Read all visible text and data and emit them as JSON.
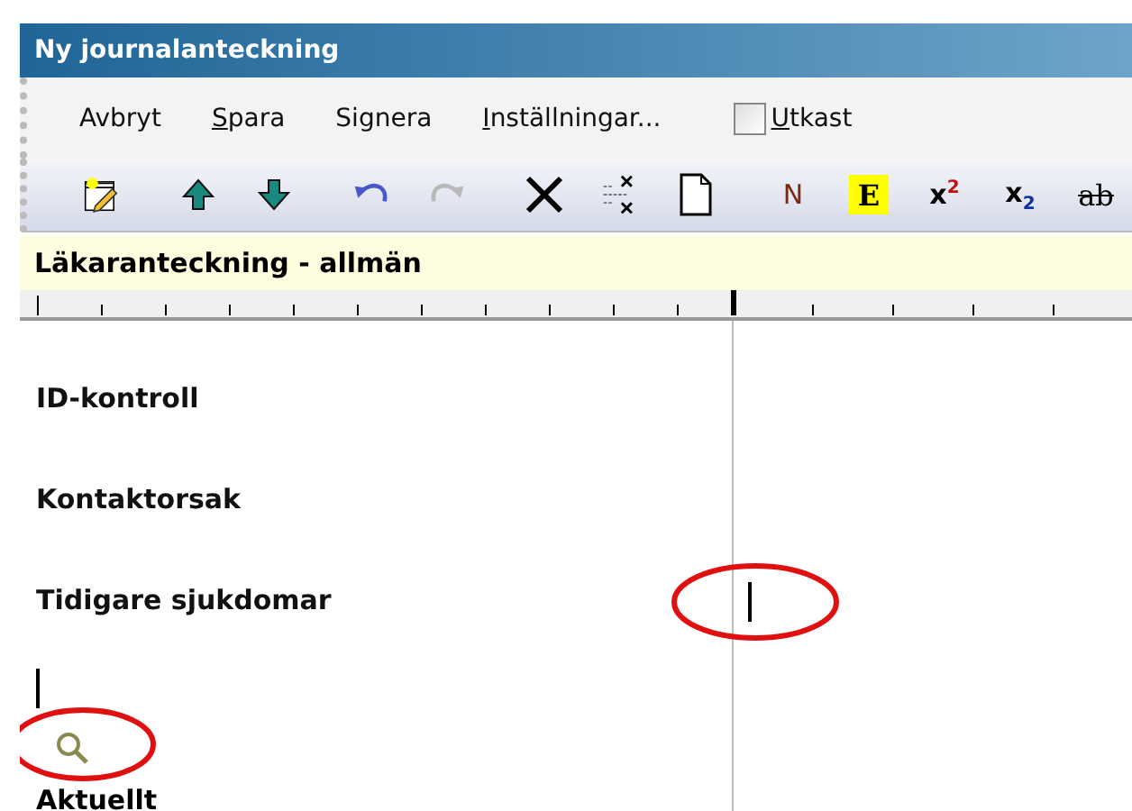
{
  "window": {
    "title": "Ny journalanteckning"
  },
  "menu": [
    {
      "before": "Avbryt"
    },
    {
      "key": "S",
      "after": "para"
    },
    {
      "before": "Si",
      "key": "g",
      "after": "nera"
    },
    {
      "key": "I",
      "after": "nställningar..."
    }
  ],
  "draft_checkbox": {
    "key": "U",
    "after": "tkast",
    "checked": false
  },
  "toolbar": [
    {
      "kind": "note"
    },
    {
      "kind": "sep"
    },
    {
      "kind": "up"
    },
    {
      "kind": "down"
    },
    {
      "kind": "sep"
    },
    {
      "kind": "undo",
      "disabled": false
    },
    {
      "kind": "redo",
      "disabled": true
    },
    {
      "kind": "sep"
    },
    {
      "kind": "delete"
    },
    {
      "kind": "delete-lines"
    },
    {
      "kind": "page"
    },
    {
      "kind": "sep"
    },
    {
      "kind": "text",
      "label": "N"
    },
    {
      "kind": "highlight",
      "label": "E"
    },
    {
      "kind": "text",
      "label": "x$^{2}$"
    },
    {
      "kind": "text",
      "label": "x$_{2}$"
    },
    {
      "kind": "strike",
      "label": "ab"
    },
    {
      "kind": "sep"
    }
  ],
  "template_title": "Läkaranteckning - allmän",
  "sections": [
    "ID-kontroll",
    "Kontaktorsak",
    "Tidigare sjukdomar"
  ],
  "search_icon": {
    "highlighted": true
  },
  "next_section": "Aktuellt",
  "right_cursor": {
    "highlighted": true
  }
}
